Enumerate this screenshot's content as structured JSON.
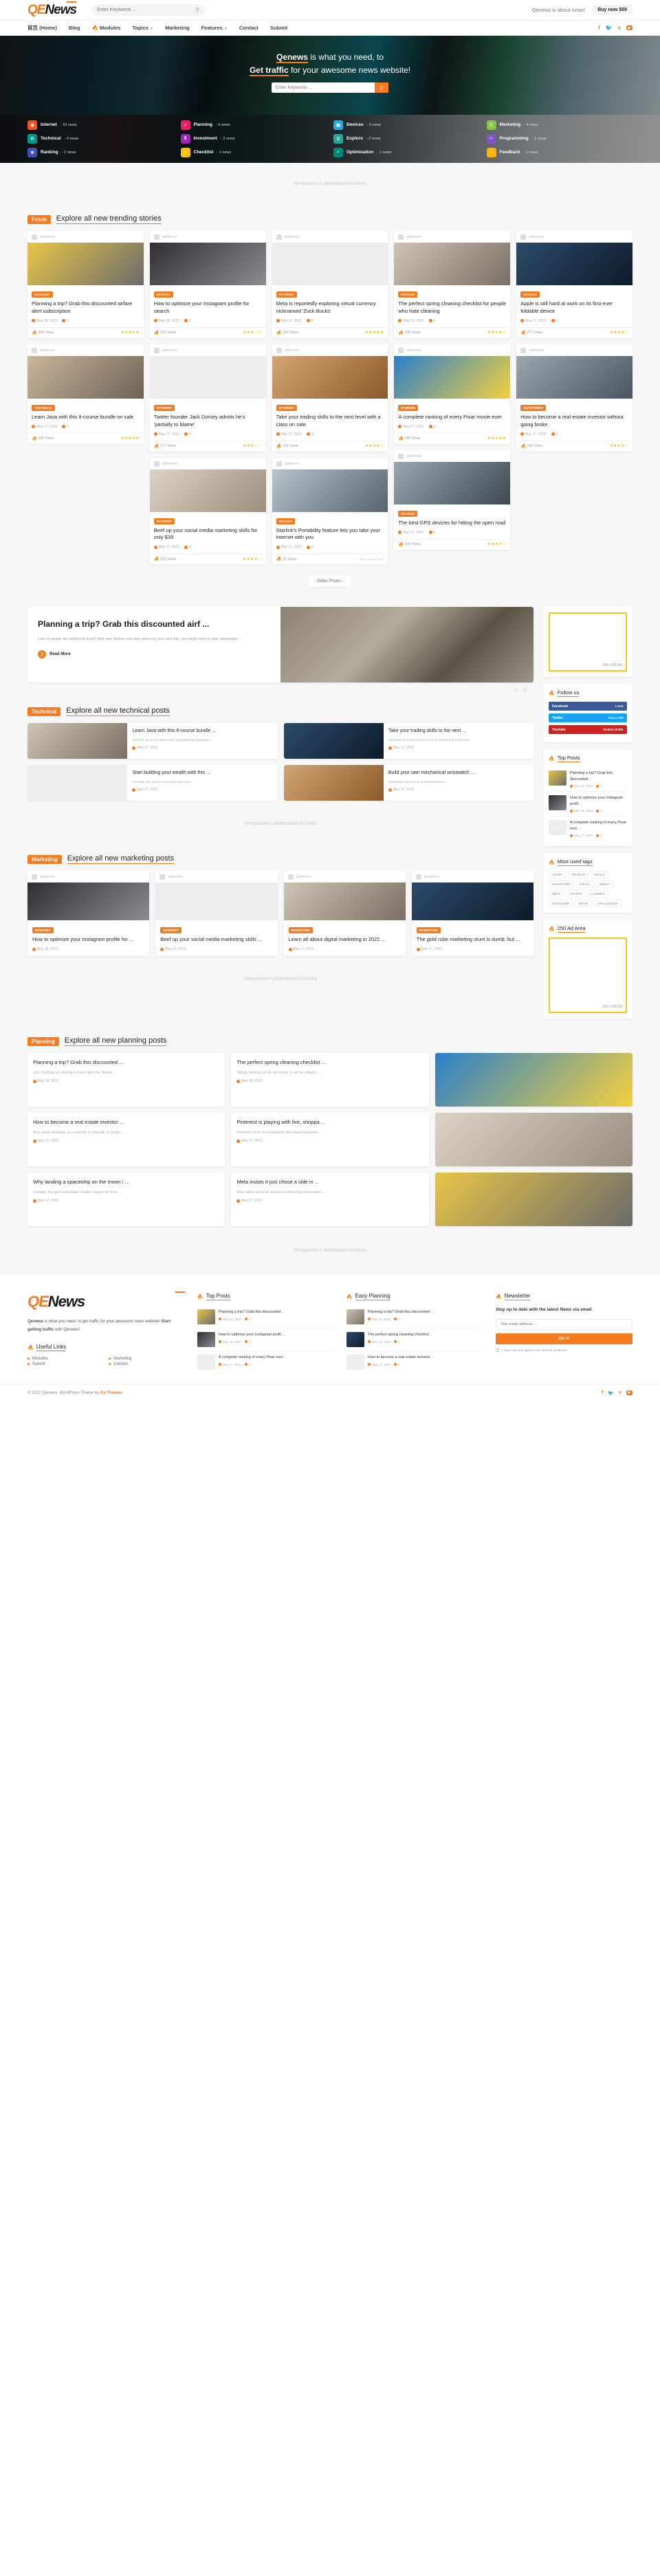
{
  "header": {
    "logo": {
      "part1": "QE",
      "part2": "News"
    },
    "search_placeholder": "Enter Keywords ...",
    "search_icon": "search-icon",
    "about_text": "Qenews is about news!",
    "buy_label": "Buy now $59"
  },
  "nav": {
    "items": [
      {
        "label": "首页 (Home)",
        "active": true,
        "caret": false,
        "fire": false
      },
      {
        "label": "Blog",
        "active": false,
        "caret": false,
        "fire": false
      },
      {
        "label": "Modules",
        "active": false,
        "caret": false,
        "fire": true
      },
      {
        "label": "Topics",
        "active": false,
        "caret": true,
        "fire": false
      },
      {
        "label": "Marketing",
        "active": false,
        "caret": false,
        "fire": false
      },
      {
        "label": "Features",
        "active": false,
        "caret": true,
        "fire": false
      },
      {
        "label": "Contact",
        "active": false,
        "caret": false,
        "fire": false
      },
      {
        "label": "Submit",
        "active": false,
        "caret": false,
        "fire": false
      }
    ],
    "social": [
      "facebook-icon",
      "twitter-icon",
      "vimeo-icon",
      "youtube-icon"
    ]
  },
  "hero": {
    "line1_strong": "Qenews",
    "line1_rest": " is what you need, to",
    "line2_strong": "Get traffic",
    "line2_rest": " for your awesome news website!",
    "form_placeholder": "Enter Keywords ...",
    "form_button_icon": "search-icon"
  },
  "categories": [
    {
      "name": "Internet",
      "count": "- 10 news",
      "color": "#f4511e",
      "icon": "brain-icon"
    },
    {
      "name": "Planning",
      "count": "- 6 news",
      "color": "#e91e63",
      "icon": "calendar-check-icon"
    },
    {
      "name": "Devices",
      "count": "- 5 news",
      "color": "#29a8e0",
      "icon": "devices-icon"
    },
    {
      "name": "Marketing",
      "count": "- 4 news",
      "color": "#8bc34a",
      "icon": "chart-icon"
    },
    {
      "name": "Technical",
      "count": "- 4 news",
      "color": "#009688",
      "icon": "gear-icon"
    },
    {
      "name": "Investment",
      "count": "- 3 news",
      "color": "#9c27b0",
      "icon": "dollar-icon"
    },
    {
      "name": "Explore",
      "count": "- 2 news",
      "color": "#26a69a",
      "icon": "google-icon"
    },
    {
      "name": "Programming",
      "count": "- 1 news",
      "color": "#7e57c2",
      "icon": "code-icon"
    },
    {
      "name": "Ranking",
      "count": "- 1 news",
      "color": "#3f51b5",
      "icon": "award-icon"
    },
    {
      "name": "Checklist",
      "count": "- 1 news",
      "color": "#ffc107",
      "icon": "list-icon"
    },
    {
      "name": "Optimization",
      "count": "- 1 news",
      "color": "#00897b",
      "icon": "magnifier-icon"
    },
    {
      "name": "Feedback",
      "count": "- 1 news",
      "color": "#ffb300",
      "icon": "comment-icon"
    }
  ],
  "ads": {
    "leaderboard": "Responsive Leaderboard Ad Area",
    "rect_label": "300 x 250 AD",
    "square_title": "250 Ad Area",
    "square_label": "250 x 250 AD"
  },
  "sections": {
    "fresh": {
      "tag": "Fresh",
      "title": "Explore all new trending stories"
    },
    "technical": {
      "tag": "Technical",
      "title": "Explore all new technical posts"
    },
    "marketing": {
      "tag": "Marketing",
      "title": "Explore all new marketing posts"
    },
    "planning": {
      "tag": "Planning",
      "title": "Explore all new planning posts"
    }
  },
  "author_label": "qethemes",
  "older_posts": "Older Posts  ›",
  "fresh_cards": [
    {
      "badge": "INTERNET",
      "badge_color": "#f47b20",
      "title": "Planning a trip? Grab this discounted airfare alert subscription",
      "date": "May 18, 2022",
      "comments": "2",
      "views": "593 Views",
      "stars": 4.5
    },
    {
      "badge": "DEVICES",
      "badge_color": "#f47b20",
      "title": "How to optimize your Instagram profile for search",
      "date": "May 18, 2022",
      "comments": "1",
      "views": "478 Views",
      "stars": 3
    },
    {
      "badge": "INTERNET",
      "badge_color": "#f47b20",
      "title": "Meta is reportedly exploring virtual currency nicknamed 'Zuck Bucks'",
      "date": "May 17, 2022",
      "comments": "0",
      "views": "233 Views",
      "stars": 5
    },
    {
      "badge": "DEVICES",
      "badge_color": "#f47b20",
      "title": "The perfect spring cleaning checklist for people who hate cleaning",
      "date": "May 18, 2022",
      "comments": "2",
      "views": "338 Views",
      "stars": 4
    },
    {
      "badge": "DEVICES",
      "badge_color": "#f47b20",
      "title": "Apple is still hard at work on its first-ever foldable device",
      "date": "May 17, 2022",
      "comments": "0",
      "views": "277 Views",
      "stars": 4
    },
    {
      "badge": "INTERNET",
      "badge_color": "#f47b20",
      "title": "Twitter founder Jack Dorsey admits he's 'partially to blame'",
      "date": "May 17, 2022",
      "comments": "0",
      "views": "177 Views",
      "stars": 3
    },
    {
      "badge": "INTERNET",
      "badge_color": "#f47b20",
      "title": "Take your trading skills to the next level with a class on sale",
      "date": "May 17, 2022",
      "comments": "0",
      "views": "190 Views",
      "stars": 4
    },
    {
      "badge": "RANKING",
      "badge_color": "#f47b20",
      "title": "A complete ranking of every Pixar movie ever",
      "date": "May 17, 2022",
      "comments": "0",
      "views": "190 Views",
      "stars": 5
    },
    {
      "badge": "INVESTMENT",
      "badge_color": "#f47b20",
      "title": "How to become a real estate investor without going broke",
      "date": "May 17, 2022",
      "comments": "0",
      "views": "165 Views",
      "stars": 4
    },
    {
      "badge": "TECHNICAL",
      "badge_color": "#f47b20",
      "title": "Learn Java with this 8-course bundle on sale",
      "date": "May 17, 2022",
      "comments": "0",
      "views": "185 Views",
      "stars": 5
    },
    {
      "badge": "INTERNET",
      "badge_color": "#f47b20",
      "title": "Beef up your social media marketing skills for only $39",
      "date": "May 17, 2022",
      "comments": "0",
      "views": "153 Views",
      "stars": 3.5
    },
    {
      "badge": "DEVICES",
      "badge_color": "#f47b20",
      "title": "Starlink's Portability feature lets you take your internet with you",
      "date": "May 17, 2022",
      "comments": "0",
      "views": "32 Views",
      "stars": 0,
      "no_rating": "No ratings yet"
    },
    {
      "badge": "DEVICES",
      "badge_color": "#f47b20",
      "title": "The best GPS devices for hitting the open road",
      "date": "May 17, 2022",
      "comments": "0",
      "views": "133 Views",
      "stars": 4
    }
  ],
  "feature": {
    "title": "Planning a trip? Grab this discounted airf ...",
    "excerpt": "Lots of people are looking to travel right now. Before you start planning your next trip, you might want to take advantage ...",
    "read_more": "Read More",
    "prev": "‹",
    "next": "›"
  },
  "widgets": {
    "follow_us": {
      "title": "Follow us",
      "icon": "heart-icon",
      "rows": [
        {
          "name": "facebook",
          "label": "Facebook",
          "action": "LIKE",
          "color": "#3b5998"
        },
        {
          "name": "twitter",
          "label": "Twitter",
          "action": "FOLLOW",
          "color": "#1da1f2"
        },
        {
          "name": "youtube",
          "label": "Youtube",
          "action": "SUBSCRIBE",
          "color": "#cd201f"
        }
      ]
    },
    "top_posts": {
      "title": "Top Posts",
      "icon": "flame-icon",
      "items": [
        {
          "title": "Planning a trip? Grab this discounted ..",
          "date": "May 18, 2022",
          "comments": "2"
        },
        {
          "title": "How to optimize your Instagram profil ..",
          "date": "May 18, 2022",
          "comments": "1"
        },
        {
          "title": "A complete ranking of every Pixar mov ..",
          "date": "May 17, 2022",
          "comments": "0"
        }
      ]
    },
    "most_used_tags": {
      "title": "Most used tags",
      "icon": "flame-icon",
      "tags": [
        "LEARN",
        "TRADING",
        "SKILLS",
        "MARKETING",
        "SOCIAL",
        "MEDIA",
        "META",
        "CRYPTO",
        "LANDING",
        "SPACESHIP",
        "MOON",
        "CHALLENGES"
      ]
    }
  },
  "technical_rows": [
    {
      "title": "Learn Java with this 8-course bundle ...",
      "excerpt": "Whether you're an experienced programming languages ...",
      "date": "May 17, 2022"
    },
    {
      "title": "Take your trading skills to the next ...",
      "excerpt": "With lifetime access to five hours of content and 23 lessons ...",
      "date": "May 17, 2022"
    },
    {
      "title": "Start building your wealth with this ...",
      "excerpt": "Investing isn't just for those who were born ...",
      "date": "May 17, 2022"
    },
    {
      "title": "Build your own mechanical wristwatch ...",
      "excerpt": "Wristwatch requires no external batteries ...",
      "date": "May 17, 2022"
    }
  ],
  "marketing_cards": [
    {
      "badge": "INTERNET",
      "title": "How to optimize your Instagram profile for ...",
      "date": "May 18, 2022"
    },
    {
      "badge": "INTERNET",
      "title": "Beef up your social media marketing skills ...",
      "date": "May 17, 2022"
    },
    {
      "badge": "MARKETING",
      "title": "Learn all about digital marketing in 2022 ...",
      "date": "May 17, 2022"
    },
    {
      "badge": "MARKETING",
      "title": "The gold rube marketing stunt is dumb, but ...",
      "date": "May 17, 2022"
    }
  ],
  "planning_cards": [
    {
      "title": "Planning a trip? Grab this discounted ...",
      "excerpt": "Lots of people are looking to travel right now. Before ...",
      "date": "May 18, 2022",
      "has_image": false
    },
    {
      "title": "The perfect spring cleaning checklist ...",
      "excerpt": "Spring cleaning can be refreshing. It can be cathartic ...",
      "date": "May 18, 2022",
      "has_image": false
    },
    {
      "title": "",
      "excerpt": "",
      "date": "",
      "has_image": true
    },
    {
      "title": "How to become a real estate investor ...",
      "excerpt": "Real estate investing, as a concept, is basically as simple ...",
      "date": "May 17, 2022",
      "has_image": false
    },
    {
      "title": "Pinterest is playing with live, shoppa ...",
      "excerpt": "Pinterest, home to moodboards and visual inspiration ...",
      "date": "May 17, 2022",
      "has_image": false
    },
    {
      "title": "",
      "excerpt": "",
      "date": "",
      "has_image": true
    },
    {
      "title": "Why landing a spaceship on the moon i ...",
      "excerpt": "Crucially, this gives astronauts smaller margins for error ...",
      "date": "May 17, 2022",
      "has_image": false
    },
    {
      "title": "Meta insists it just chose a side in ...",
      "excerpt": "Meta said it would be used as a refreshing conversation ...",
      "date": "May 17, 2022",
      "has_image": false
    },
    {
      "title": "",
      "excerpt": "",
      "date": "",
      "has_image": true
    }
  ],
  "footer": {
    "logo": {
      "part1": "QE",
      "part2": "News"
    },
    "about_b1": "Qenews",
    "about_t1": " is what you need, to get traffic for your awesome news website! ",
    "about_b2": "Start getting traffic",
    "about_t2": " with Qenews!",
    "useful_links_title": "Useful Links",
    "useful_links": [
      "Modules",
      "Marketing",
      "Submit",
      "Contact"
    ],
    "top_posts_title": "Top Posts",
    "top_posts": [
      {
        "title": "Planning a trip? Grab this discounted ..",
        "date": "May 18, 2022",
        "comments": "2"
      },
      {
        "title": "How to optimize your Instagram profil ..",
        "date": "May 18, 2022",
        "comments": "1"
      },
      {
        "title": "A complete ranking of every Pixar mov ..",
        "date": "May 17, 2022",
        "comments": "0"
      }
    ],
    "easy_planning_title": "Easy Planning",
    "easy_planning": [
      {
        "title": "Planning a trip? Grab this discounted ..",
        "date": "May 18, 2022",
        "comments": "2"
      },
      {
        "title": "The perfect spring cleaning checklist ..",
        "date": "May 18, 2022",
        "comments": "2"
      },
      {
        "title": "How to become a real estate investor ..",
        "date": "May 17, 2022",
        "comments": "0"
      }
    ],
    "newsletter_title": "Newsletter",
    "newsletter_text": "Stay up to date with the latest News via email",
    "newsletter_placeholder": "Your email address ...",
    "newsletter_button": "Go in",
    "newsletter_consent": "I have read and agree to the terms & conditions",
    "copyright": "© 2022 Qenews. WordPress Theme by",
    "copyright_brand": "Ax Themes",
    "social": [
      "facebook-icon",
      "twitter-icon",
      "vimeo-icon",
      "youtube-icon"
    ]
  }
}
